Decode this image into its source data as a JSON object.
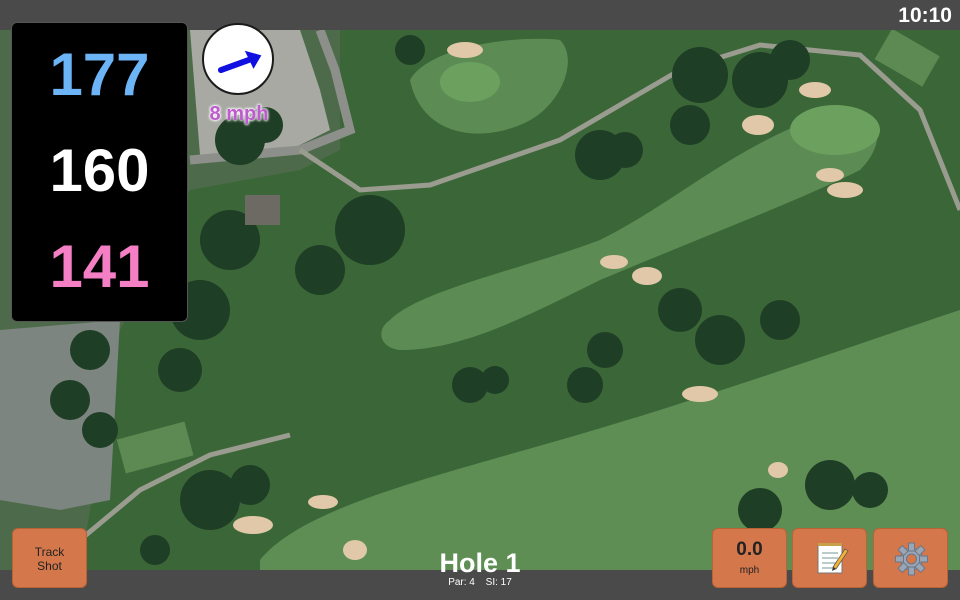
{
  "status": {
    "time": "10:10"
  },
  "distances": {
    "back": "177",
    "middle": "160",
    "front": "141"
  },
  "wind": {
    "speed_label": "8 mph",
    "direction_deg": -20,
    "icon": "wind-arrow-icon"
  },
  "hole": {
    "title": "Hole 1",
    "par": "Par: 4",
    "si": "SI: 17"
  },
  "buttons": {
    "track_shot": "Track\nShot",
    "speed_value": "0.0",
    "speed_unit": "mph",
    "notes_icon": "notepad-icon",
    "settings_icon": "gear-icon"
  },
  "colors": {
    "back_distance": "#6cb4f5",
    "middle_distance": "#ffffff",
    "front_distance": "#f47fc4",
    "button_bg": "#d4774a",
    "wind_text": "#c05ad0"
  }
}
